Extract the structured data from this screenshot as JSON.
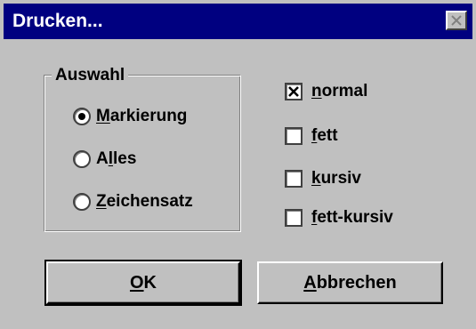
{
  "dialog": {
    "title": "Drucken...",
    "close_icon": "close-icon"
  },
  "selection_group": {
    "legend": "Auswahl",
    "options": [
      {
        "mnemonic": "M",
        "rest": "arkierung",
        "selected": true
      },
      {
        "pre": "A",
        "mnemonic": "l",
        "rest": "les",
        "selected": false
      },
      {
        "mnemonic": "Z",
        "rest": "eichensatz",
        "selected": false
      }
    ]
  },
  "style_options": [
    {
      "mnemonic": "n",
      "rest": "ormal",
      "checked": true
    },
    {
      "mnemonic": "f",
      "rest": "ett",
      "checked": false
    },
    {
      "mnemonic": "k",
      "rest": "ursiv",
      "checked": false
    },
    {
      "mnemonic": "f",
      "rest": "ett-kursiv",
      "checked": false
    }
  ],
  "buttons": {
    "ok": {
      "mnemonic": "O",
      "rest": "K"
    },
    "cancel": {
      "mnemonic": "A",
      "rest": "bbrechen"
    }
  },
  "colors": {
    "titlebar": "#000080",
    "face": "#c0c0c0"
  }
}
